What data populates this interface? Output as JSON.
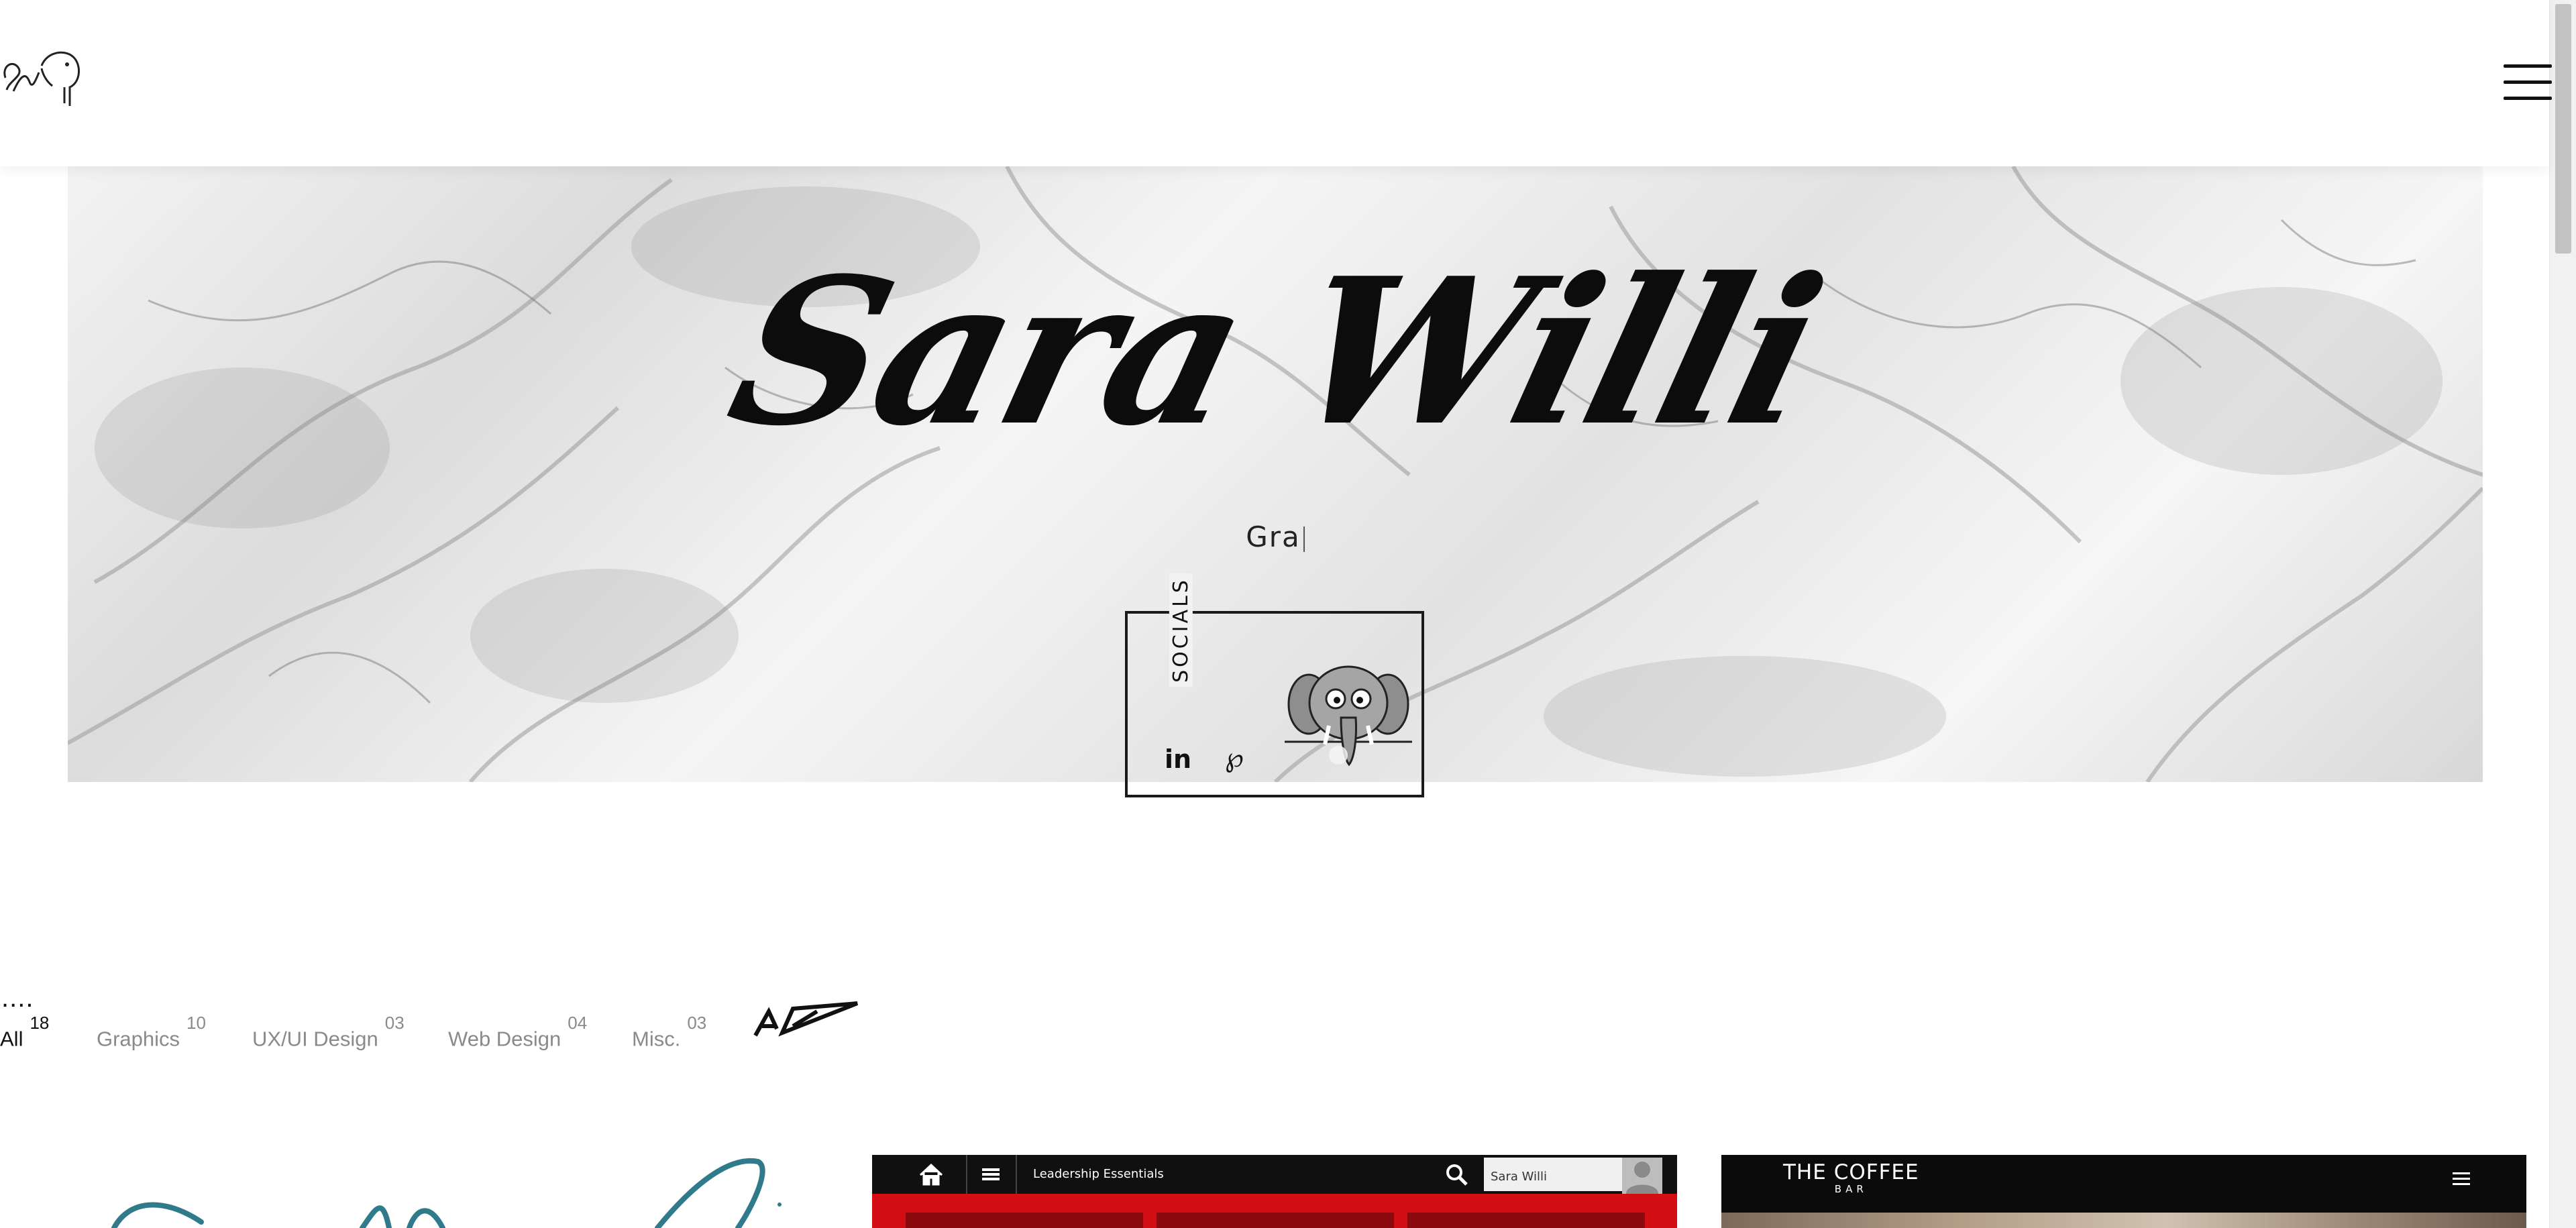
{
  "header": {
    "logo_name": "sw-elephant-logo",
    "menu_icon": "hamburger-menu-icon"
  },
  "hero": {
    "title": "Sara Willi",
    "subtitle_typing": "Gra",
    "socials_label": "SOCIALS",
    "social_links": [
      {
        "name": "linkedin",
        "glyph": "in"
      },
      {
        "name": "pinterest",
        "glyph": "℘"
      }
    ]
  },
  "portfolio_filters": {
    "dots": "....",
    "items": [
      {
        "label": "All",
        "count": "18",
        "active": true
      },
      {
        "label": "Graphics",
        "count": "10",
        "active": false
      },
      {
        "label": "UX/UI Design",
        "count": "03",
        "active": false
      },
      {
        "label": "Web Design",
        "count": "04",
        "active": false
      },
      {
        "label": "Misc.",
        "count": "03",
        "active": false
      }
    ]
  },
  "cards": {
    "leadership": {
      "title": "Leadership Essentials",
      "user_name": "Sara Willi",
      "accent": "#d20d14"
    },
    "coffee": {
      "logo_line1": "THE COFFEE",
      "logo_line2": "BAR"
    }
  },
  "colors": {
    "text": "#111111",
    "muted": "#8a8a8a",
    "accent_red": "#d20d14",
    "teal_script": "#2f7b8c"
  }
}
